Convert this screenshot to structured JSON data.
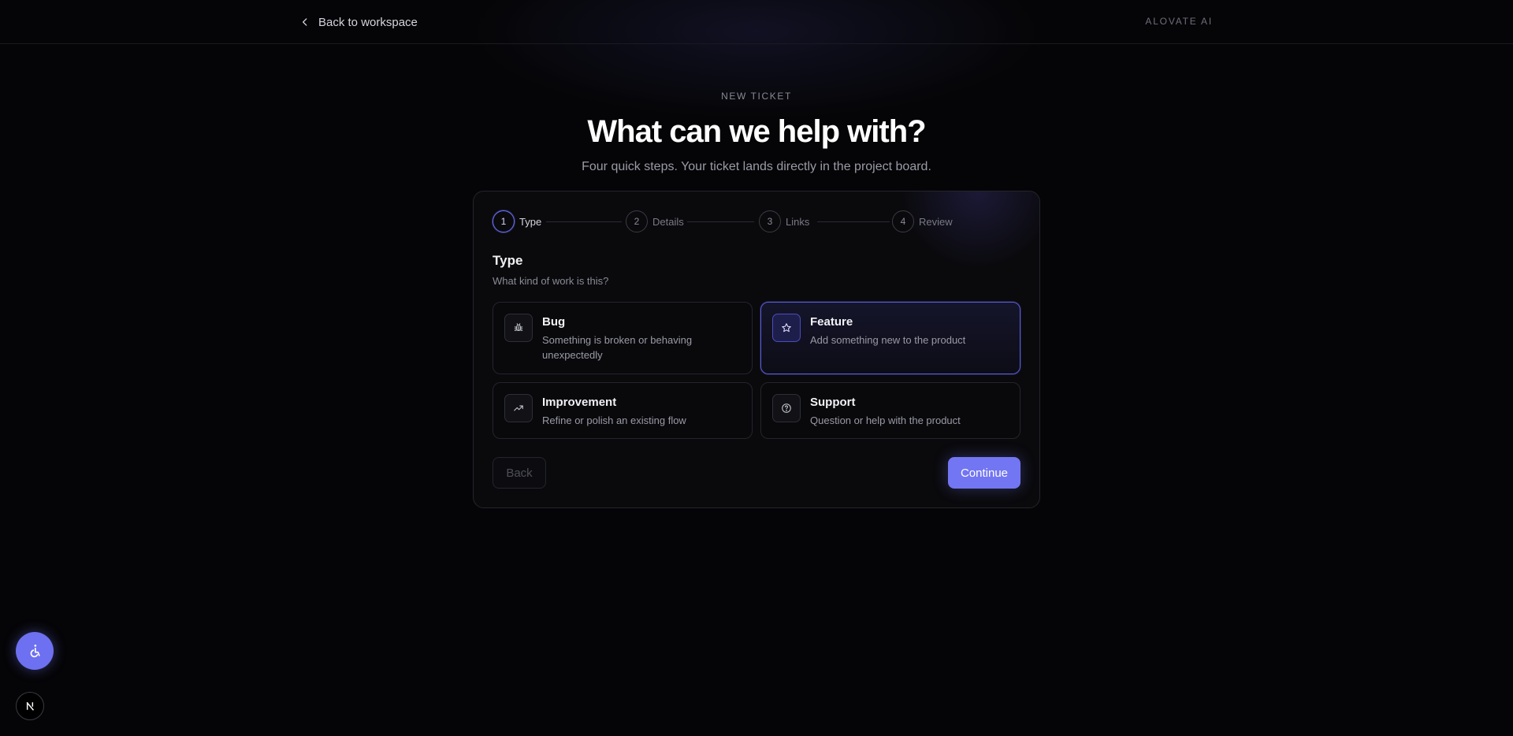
{
  "topbar": {
    "back_label": "Back to workspace",
    "brand": "ALOVATE AI"
  },
  "hero": {
    "eyebrow": "NEW TICKET",
    "title": "What can we help with?",
    "subtitle": "Four quick steps. Your ticket lands directly in the project board."
  },
  "stepper": {
    "steps": [
      {
        "num": "1",
        "label": "Type",
        "active": true
      },
      {
        "num": "2",
        "label": "Details",
        "active": false
      },
      {
        "num": "3",
        "label": "Links",
        "active": false
      },
      {
        "num": "4",
        "label": "Review",
        "active": false
      }
    ]
  },
  "section": {
    "title": "Type",
    "subtitle": "What kind of work is this?"
  },
  "options": [
    {
      "title": "Bug",
      "desc": "Something is broken or behaving unexpectedly",
      "icon": "bug-icon",
      "selected": false
    },
    {
      "title": "Feature",
      "desc": "Add something new to the product",
      "icon": "star-icon",
      "selected": true
    },
    {
      "title": "Improvement",
      "desc": "Refine or polish an existing flow",
      "icon": "trending-up-icon",
      "selected": false
    },
    {
      "title": "Support",
      "desc": "Question or help with the product",
      "icon": "help-circle-icon",
      "selected": false
    }
  ],
  "actions": {
    "back_label": "Back",
    "continue_label": "Continue"
  },
  "colors": {
    "accent": "#7276f2",
    "background": "#050507"
  }
}
